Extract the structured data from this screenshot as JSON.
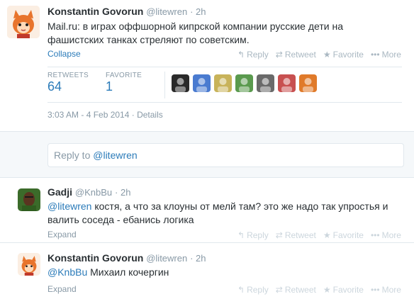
{
  "main_tweet": {
    "author_name": "Konstantin Govorun",
    "handle": "@litewren",
    "age": "· 2h",
    "text": "Mail.ru: в играх оффшорной кипрской компании русские дети на фашистских танках стреляют по советским.",
    "collapse": "Collapse",
    "actions": {
      "reply": "Reply",
      "retweet": "Retweet",
      "favorite": "Favorite",
      "more": "More"
    },
    "stats": {
      "retweets_label": "RETWEETS",
      "retweets": "64",
      "favorite_label": "FAVORITE",
      "favorite": "1"
    },
    "timestamp": "3:03 AM - 4 Feb 2014",
    "details": "· Details",
    "mini_avatar_colors": [
      "#2a2a2a",
      "#4a7bd0",
      "#c8b35a",
      "#5a9a4e",
      "#6a6a6a",
      "#c85050",
      "#e07a2a"
    ]
  },
  "reply_box": {
    "prefix": "Reply to ",
    "mention": "@litewren"
  },
  "replies": [
    {
      "author_name": "Gadji",
      "handle": "@KnbBu",
      "age": "· 2h",
      "mention": "@litewren",
      "text": " костя, а что за клоуны от мелй там? это же надо так упростья и валить соседа - ебанись логика",
      "expand": "Expand",
      "actions": {
        "reply": "Reply",
        "retweet": "Retweet",
        "favorite": "Favorite",
        "more": "More"
      }
    },
    {
      "author_name": "Konstantin Govorun",
      "handle": "@litewren",
      "age": "· 2h",
      "mention": "@KnbBu",
      "text": " Михаил кочергин",
      "expand": "Expand",
      "actions": {
        "reply": "Reply",
        "retweet": "Retweet",
        "favorite": "Favorite",
        "more": "More"
      }
    }
  ]
}
